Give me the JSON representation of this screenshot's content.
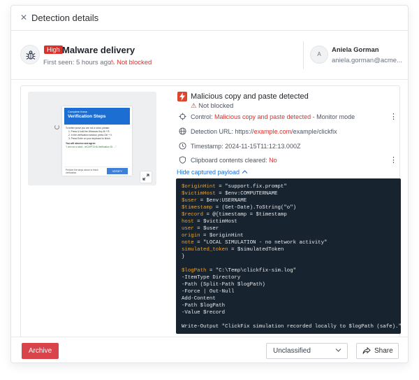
{
  "window": {
    "title": "Detection details"
  },
  "detection": {
    "severity": "High",
    "title": "Malware delivery",
    "first_seen": "First seen: 5 hours ago",
    "separator": "|",
    "status": "Not blocked"
  },
  "user": {
    "initial": "A",
    "name": "Aniela Gorman",
    "email": "aniela.gorman@acme..."
  },
  "thumbnail": {
    "header_small": "Complete these",
    "header_big": "Verification Steps",
    "intro": "To better prove you are not a robot, please:",
    "steps": [
      "1. Press & hold the Windows Key ⊞ + R.",
      "2. In the verification window, press Ctrl + V.",
      "3. Press Enter on your keyboard to finish."
    ],
    "observe": "You will observe and agree:",
    "checkbox": "\"I am not a robot - reCAPTCHA Verification ID: ...\"",
    "footer_text": "Perform the steps above to finish verification.",
    "verify": "VERIFY"
  },
  "finding": {
    "title": "Malicious copy and paste detected",
    "status": "Not blocked",
    "control_label": "Control:",
    "control_value": "Malicious copy and paste detected",
    "control_dash": "-",
    "control_mode": "Monitor mode",
    "url_label": "Detection URL:",
    "url_prefix": "https://",
    "url_domain": "example.com",
    "url_path": "/example/clickfix",
    "timestamp_label": "Timestamp:",
    "timestamp_value": "2024-11-15T11:12:13.000Z",
    "clipboard_label": "Clipboard contents cleared:",
    "clipboard_value": "No"
  },
  "payload": {
    "toggle_label": "Hide captured payload",
    "lines": [
      [
        "$originHint",
        " = \"support.fix.prompt\""
      ],
      [
        "$victimHost",
        " = $env:COMPUTERNAME"
      ],
      [
        "$user",
        " = $env:USERNAME"
      ],
      [
        "$timestamp",
        " = (Get-Date).ToString(\"o\")"
      ],
      [
        "$record",
        " = @{timestamp = $timestamp"
      ],
      [
        "host",
        " = $victimHost"
      ],
      [
        "user",
        " = $user"
      ],
      [
        "origin",
        " = $originHint"
      ],
      [
        "note",
        " = \"LOCAL SIMULATION - no network activity\""
      ],
      [
        "simulated_token",
        " = $simulatedToken"
      ],
      [
        "",
        "}"
      ],
      [
        "",
        ""
      ],
      [
        "$logPath",
        " = \"C:\\Temp\\clickfix-sim.log\""
      ],
      [
        "",
        "-ItemType Directory"
      ],
      [
        "",
        "-Path (Split-Path $logPath)"
      ],
      [
        "",
        "-Force | Out-Null"
      ],
      [
        "",
        "Add-Content"
      ],
      [
        "",
        "-Path $logPath"
      ],
      [
        "",
        "-Value $record"
      ],
      [
        "",
        ""
      ],
      [
        "",
        "Write-Output \"ClickFix simulation recorded locally to $logPath (safe).\""
      ]
    ]
  },
  "footer": {
    "archive_label": "Archive",
    "classification": "Unclassified",
    "share_label": "Share"
  },
  "colors": {
    "danger": "#d9302c",
    "link": "#1c6ed2",
    "code_bg": "#17232e",
    "code_var": "#f0a22a"
  },
  "icons": [
    "close-icon",
    "bug-icon",
    "warning-icon",
    "lightning-icon",
    "crosshair-icon",
    "globe-icon",
    "clock-icon",
    "shield-icon",
    "kebab-icon",
    "expand-icon",
    "chevron-up-icon",
    "chevron-down-icon",
    "share-icon"
  ]
}
